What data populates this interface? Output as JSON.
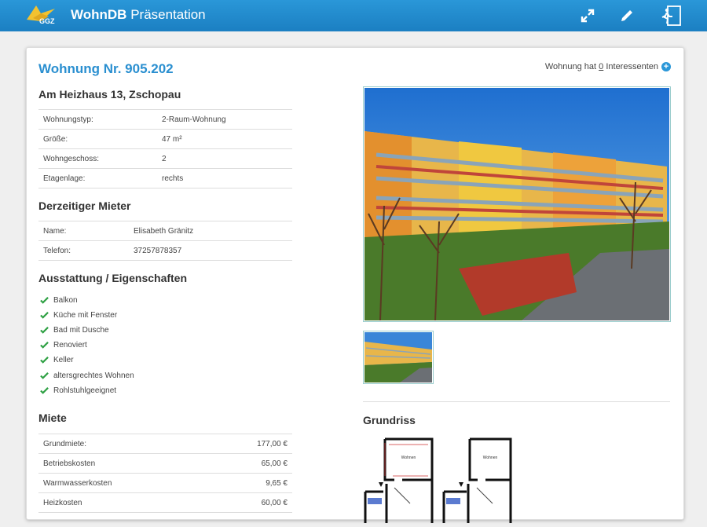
{
  "header": {
    "logo_text": "GGZ",
    "app_name": "WohnDB",
    "app_suffix": "Präsentation"
  },
  "toolbar": {
    "expand_icon": "expand-icon",
    "edit_icon": "pencil-icon",
    "exit_icon": "exit-icon"
  },
  "apartment": {
    "title": "Wohnung Nr. 905.202",
    "interest_prefix": "Wohnung hat ",
    "interest_count": "0",
    "interest_suffix": " Interessenten",
    "address": "Am Heizhaus 13, Zschopau"
  },
  "details": [
    {
      "label": "Wohnungstyp:",
      "value": "2-Raum-Wohnung"
    },
    {
      "label": "Größe:",
      "value": "47 m²"
    },
    {
      "label": "Wohngeschoss:",
      "value": "2"
    },
    {
      "label": "Etagenlage:",
      "value": "rechts"
    }
  ],
  "tenant": {
    "heading": "Derzeitiger Mieter",
    "name_label": "Name:",
    "name": "Elisabeth Gränitz",
    "phone_label": "Telefon:",
    "phone": "37257878357"
  },
  "features": {
    "heading": "Ausstattung / Eigenschaften",
    "items": [
      "Balkon",
      "Küche mit Fenster",
      "Bad mit Dusche",
      "Renoviert",
      "Keller",
      "altersgrechtes Wohnen",
      "Rohlstuhlgeeignet"
    ]
  },
  "rent": {
    "heading": "Miete",
    "rows": [
      {
        "label": "Grundmiete:",
        "value": "177,00 €"
      },
      {
        "label": "Betriebskosten",
        "value": "65,00 €"
      },
      {
        "label": "Warmwasserkosten",
        "value": "9,65 €"
      },
      {
        "label": "Heizkosten",
        "value": "60,00 €"
      }
    ]
  },
  "floorplan": {
    "heading": "Grundriss"
  },
  "colors": {
    "accent": "#2a8fd0",
    "topbar": "#1b7fc2",
    "check": "#2ea043"
  }
}
